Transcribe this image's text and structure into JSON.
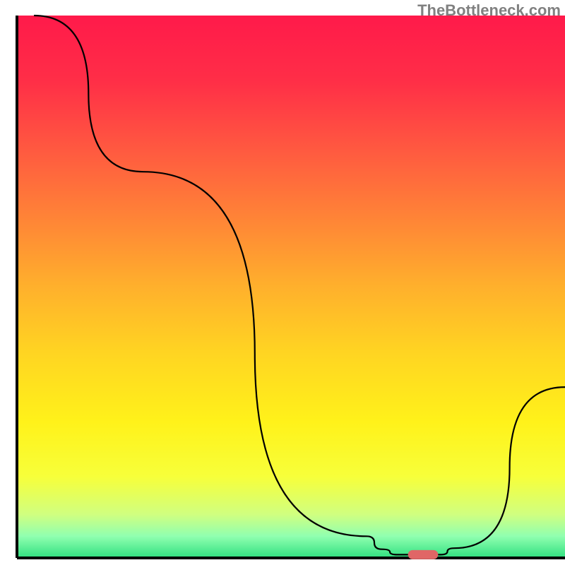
{
  "watermark": "TheBottleneck.com",
  "chart_data": {
    "type": "line",
    "title": "",
    "xlabel": "",
    "ylabel": "",
    "xlim": [
      0,
      100
    ],
    "ylim": [
      0,
      100
    ],
    "grid": false,
    "axes": {
      "left_x": 3,
      "right_x": 100,
      "bottom_y": 0,
      "top_y": 100
    },
    "curve_points": [
      {
        "x": 3.1,
        "y": 100
      },
      {
        "x": 23.0,
        "y": 71.2
      },
      {
        "x": 63.8,
        "y": 4.0
      },
      {
        "x": 66.6,
        "y": 1.6
      },
      {
        "x": 69.5,
        "y": 0.6
      },
      {
        "x": 77.3,
        "y": 0.6
      },
      {
        "x": 79.8,
        "y": 1.8
      },
      {
        "x": 100.0,
        "y": 31.5
      }
    ],
    "marker": {
      "x_center": 74.1,
      "y_center": 0.6,
      "width": 5.5,
      "height": 1.7,
      "color": "#e06666",
      "shape": "rounded-rect"
    },
    "gradient_stops": [
      {
        "offset": 0,
        "color": "#ff1a4a"
      },
      {
        "offset": 12,
        "color": "#ff2e47"
      },
      {
        "offset": 25,
        "color": "#ff5a40"
      },
      {
        "offset": 38,
        "color": "#ff8636"
      },
      {
        "offset": 50,
        "color": "#ffb02c"
      },
      {
        "offset": 62,
        "color": "#ffd422"
      },
      {
        "offset": 75,
        "color": "#fff21a"
      },
      {
        "offset": 85,
        "color": "#f7ff3a"
      },
      {
        "offset": 92,
        "color": "#d0ff80"
      },
      {
        "offset": 96,
        "color": "#90ffb0"
      },
      {
        "offset": 100,
        "color": "#30e080"
      }
    ],
    "description": "Bottleneck V-curve over a vertical heat gradient; curve dips to a minimum plateau near x≈66–77 and rises on both sides. A small rounded marker highlights the optimal region on the x-axis."
  }
}
